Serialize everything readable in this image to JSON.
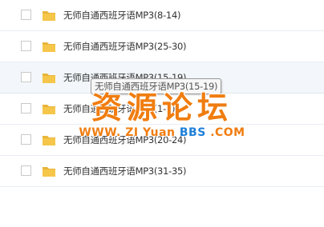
{
  "files": [
    {
      "name": "无师自通西班牙语MP3(8-14)"
    },
    {
      "name": "无师自通西班牙语MP3(25-30)"
    },
    {
      "name": "无师自通西班牙语MP3(15-19)"
    },
    {
      "name": "无师自通西班牙语MP3(1-7)"
    },
    {
      "name": "无师自通西班牙语MP3(20-24)"
    },
    {
      "name": "无师自通西班牙语MP3(31-35)"
    }
  ],
  "tooltip": "无师自通西班牙语MP3(15-19)",
  "watermark": {
    "title": "资源论坛",
    "url_www": "WWW.",
    "url_zi": "ZI",
    "url_yuan": "Yuan",
    "url_bbs": "BBS",
    "url_com": ".COM"
  },
  "colors": {
    "folder": "#f5c64a",
    "watermark_orange": "#f07d10",
    "watermark_blue": "#1e7fd8"
  }
}
